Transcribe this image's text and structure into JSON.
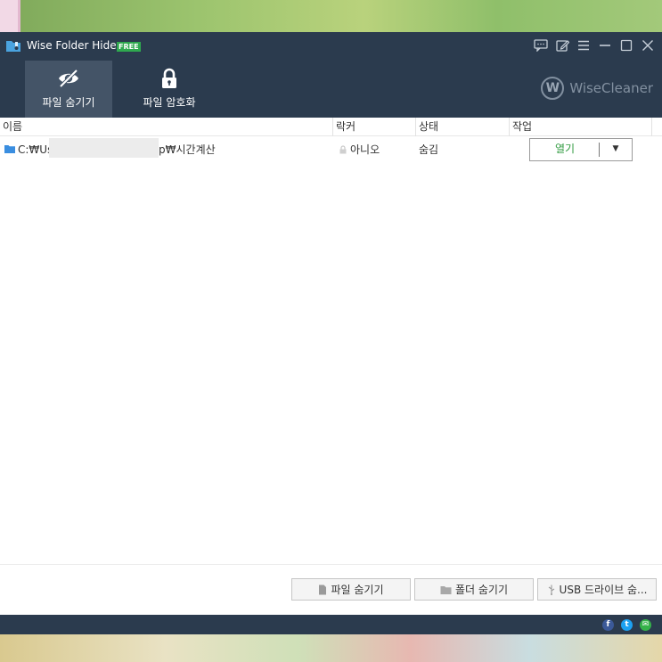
{
  "app": {
    "title": "Wise Folder Hider",
    "badge": "FREE",
    "brand": "WiseCleaner",
    "brand_logo_letter": "W"
  },
  "title_controls": [
    "message-icon",
    "edit-icon",
    "menu-icon",
    "minimize-icon",
    "maximize-icon",
    "close-icon"
  ],
  "tabs": [
    {
      "label": "파일 숨기기",
      "icon": "eye-slash-icon",
      "active": true
    },
    {
      "label": "파일 암호화",
      "icon": "lock-icon",
      "active": false
    }
  ],
  "table": {
    "columns": [
      "이름",
      "락커",
      "상태",
      "작업"
    ],
    "rows": [
      {
        "name_start": "C:₩Us",
        "name_end": "p₩시간계산",
        "locker": "아니오",
        "status": "숨김",
        "action": "열기",
        "action_dropdown": "▼"
      }
    ]
  },
  "footer_buttons": [
    {
      "label": "파일 숨기기",
      "icon": "file-icon"
    },
    {
      "label": "폴더 숨기기",
      "icon": "folder-icon"
    },
    {
      "label": "USB 드라이브 숨...",
      "icon": "usb-icon"
    }
  ],
  "social": [
    {
      "icon": "facebook-icon",
      "glyph": "f",
      "color": "#3b5998"
    },
    {
      "icon": "twitter-icon",
      "glyph": "t",
      "color": "#1da1f2"
    },
    {
      "icon": "email-icon",
      "glyph": "✉",
      "color": "#35b24a"
    }
  ],
  "colors": {
    "titlebar": "#2b3b4e",
    "active_tab": "#445467",
    "open_text": "#2f9a3f",
    "badge": "#2fa84f"
  }
}
